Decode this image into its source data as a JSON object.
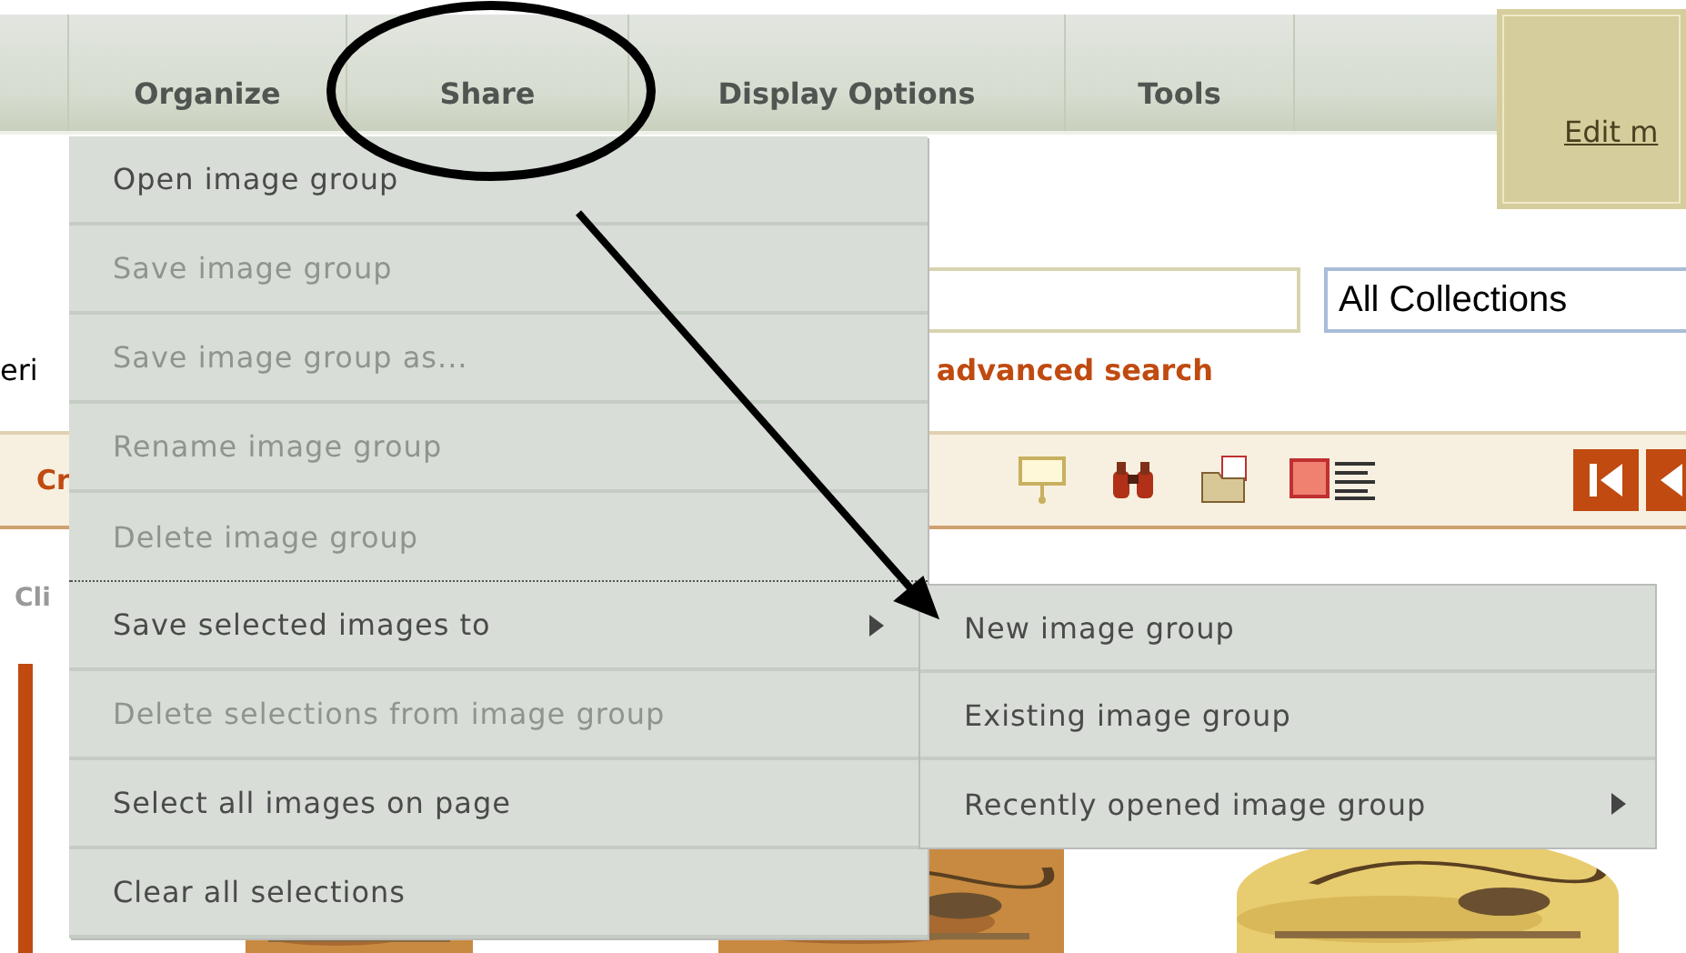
{
  "menubar": {
    "tabs": [
      {
        "label": "Organize"
      },
      {
        "label": "Share"
      },
      {
        "label": "Display Options"
      },
      {
        "label": "Tools"
      }
    ]
  },
  "side_panel": {
    "link": "Edit m"
  },
  "search": {
    "collection": "All Collections",
    "cut_text": "eri",
    "advanced_link": "advanced search"
  },
  "toolbar": {
    "label": "Cr"
  },
  "hint": "Cli",
  "menu": {
    "items": [
      {
        "label": "Open image group",
        "disabled": false,
        "submenu": false
      },
      {
        "label": "Save image group",
        "disabled": true,
        "submenu": false
      },
      {
        "label": "Save image group as...",
        "disabled": true,
        "submenu": false
      },
      {
        "label": "Rename image group",
        "disabled": true,
        "submenu": false
      },
      {
        "label": "Delete image group",
        "disabled": true,
        "submenu": false
      },
      {
        "label": "Save selected images to",
        "disabled": false,
        "submenu": true
      },
      {
        "label": "Delete selections from image group",
        "disabled": true,
        "submenu": false
      },
      {
        "label": "Select all images on page",
        "disabled": false,
        "submenu": false
      },
      {
        "label": "Clear all selections",
        "disabled": false,
        "submenu": false
      }
    ]
  },
  "submenu": {
    "items": [
      {
        "label": "New image group",
        "submenu": false
      },
      {
        "label": "Existing image group",
        "submenu": false
      },
      {
        "label": "Recently opened image group",
        "submenu": true
      }
    ]
  }
}
